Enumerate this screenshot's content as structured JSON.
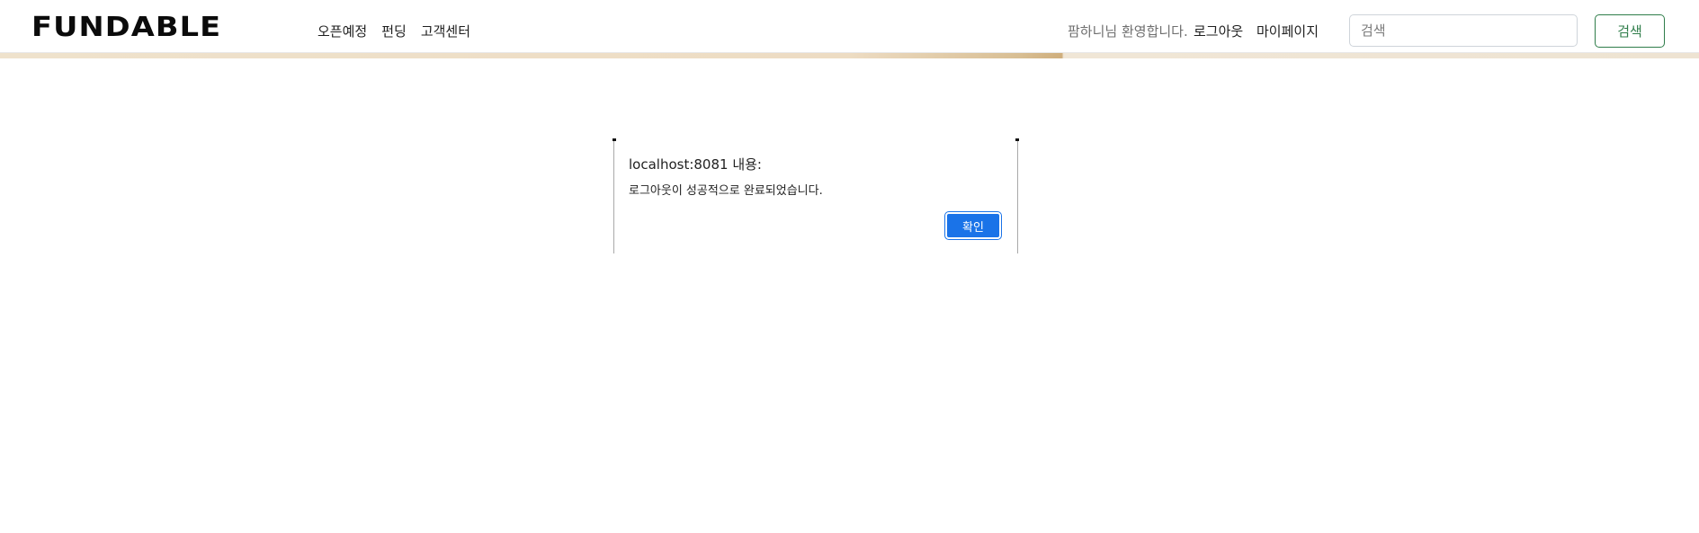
{
  "header": {
    "logo": "FUNDABLE",
    "nav": [
      "오픈예정",
      "펀딩",
      "고객센터"
    ],
    "welcome": "팜하니님 환영합니다.",
    "logout": "로그아웃",
    "mypage": "마이페이지",
    "search_placeholder": "검색",
    "search_button": "검색"
  },
  "dialog": {
    "title": "localhost:8081 내용:",
    "message": "로그아웃이 성공적으로 완료되었습니다.",
    "ok_label": "확인"
  },
  "colors": {
    "accent_green": "#2f7d4a",
    "dialog_button": "#1a73e8",
    "stripe": "#eddcc3"
  }
}
